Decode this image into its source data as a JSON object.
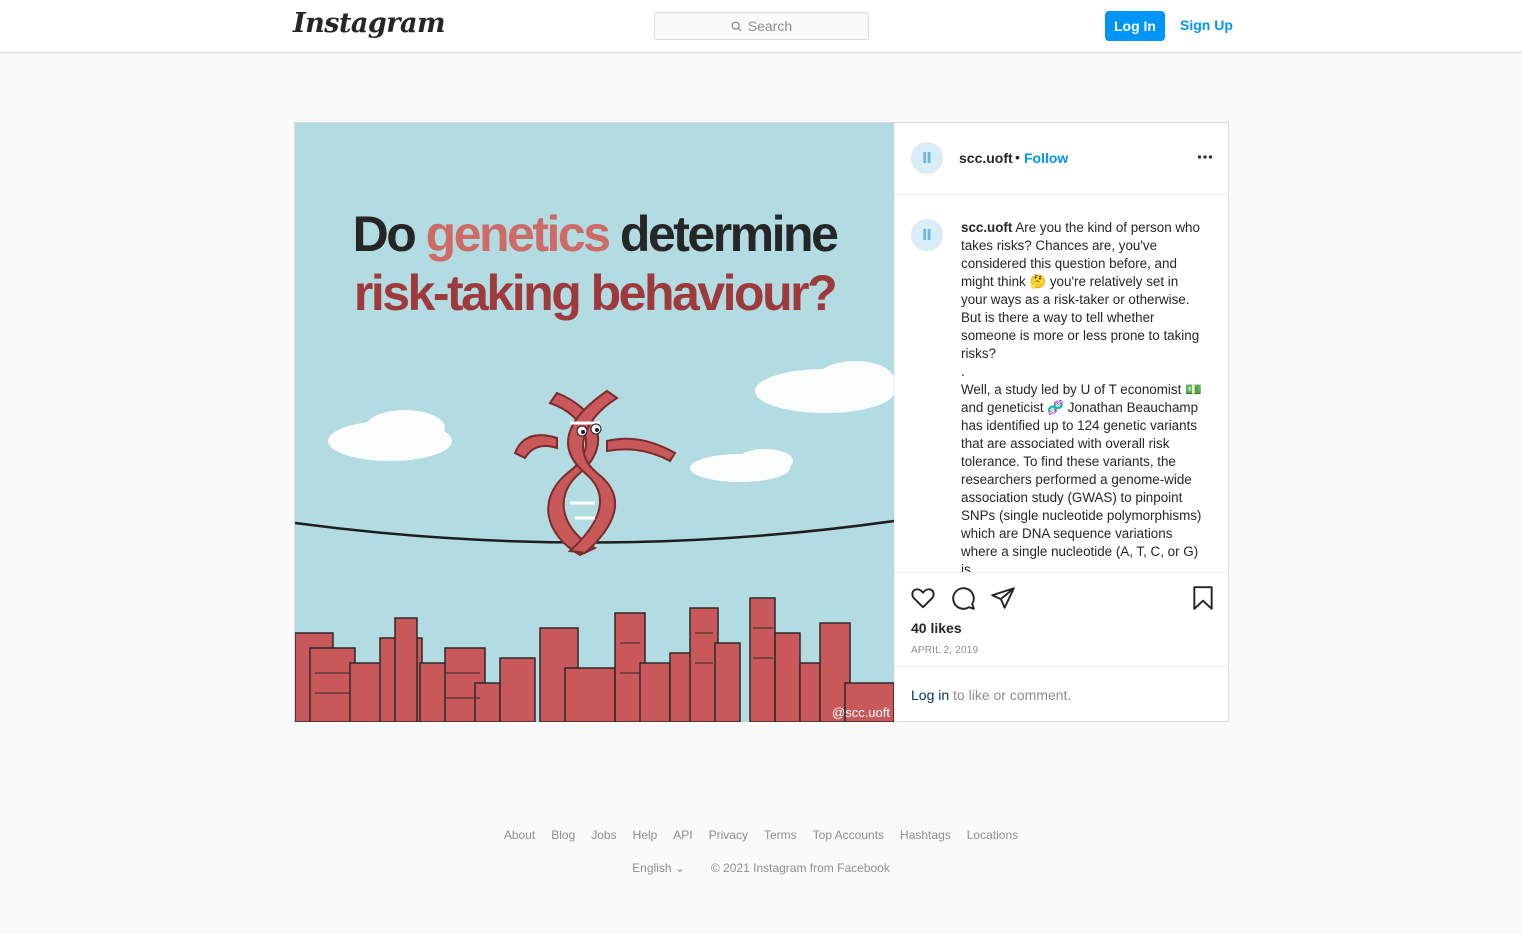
{
  "nav": {
    "logo": "Instagram",
    "search_placeholder": "Search",
    "login_label": "Log In",
    "signup_label": "Sign Up"
  },
  "post": {
    "image": {
      "headline_line1_part1": "Do ",
      "headline_line1_accent": "genetics",
      "headline_line1_part2": " determine",
      "headline_line2": "risk-taking behaviour?",
      "watermark": "@scc.uoft"
    },
    "header": {
      "username": "scc.uoft",
      "separator": "•",
      "follow_label": "Follow"
    },
    "caption": {
      "username": "scc.uoft",
      "paragraph1": "Are you the kind of person who takes risks? Chances are, you've considered this question before, and might think 🤔 you're relatively set in your ways as a risk-taker or otherwise. But is there a way to tell whether someone is more or less prone to taking risks?",
      "separator": ".",
      "paragraph2": "Well, a study led by U of T economist 💵 and geneticist 🧬 Jonathan Beauchamp has identified up to 124 genetic variants that are associated with overall risk tolerance. To find these variants, the researchers performed a genome-wide association study (GWAS) to pinpoint SNPs (single nucleotide polymorphisms) which are DNA sequence variations where a single nucleotide (A, T, C, or G) is"
    },
    "likes": "40 likes",
    "date": "APRIL 2, 2019",
    "comment_prompt": {
      "login_link": "Log in",
      "rest": " to like or comment."
    }
  },
  "footer": {
    "links": [
      "About",
      "Blog",
      "Jobs",
      "Help",
      "API",
      "Privacy",
      "Terms",
      "Top Accounts",
      "Hashtags",
      "Locations"
    ],
    "language": "English",
    "copyright": "© 2021 Instagram from Facebook"
  },
  "colors": {
    "accent_blue": "#0095f6",
    "image_bg": "#b3dbe2",
    "dna_red": "#c9585a"
  }
}
